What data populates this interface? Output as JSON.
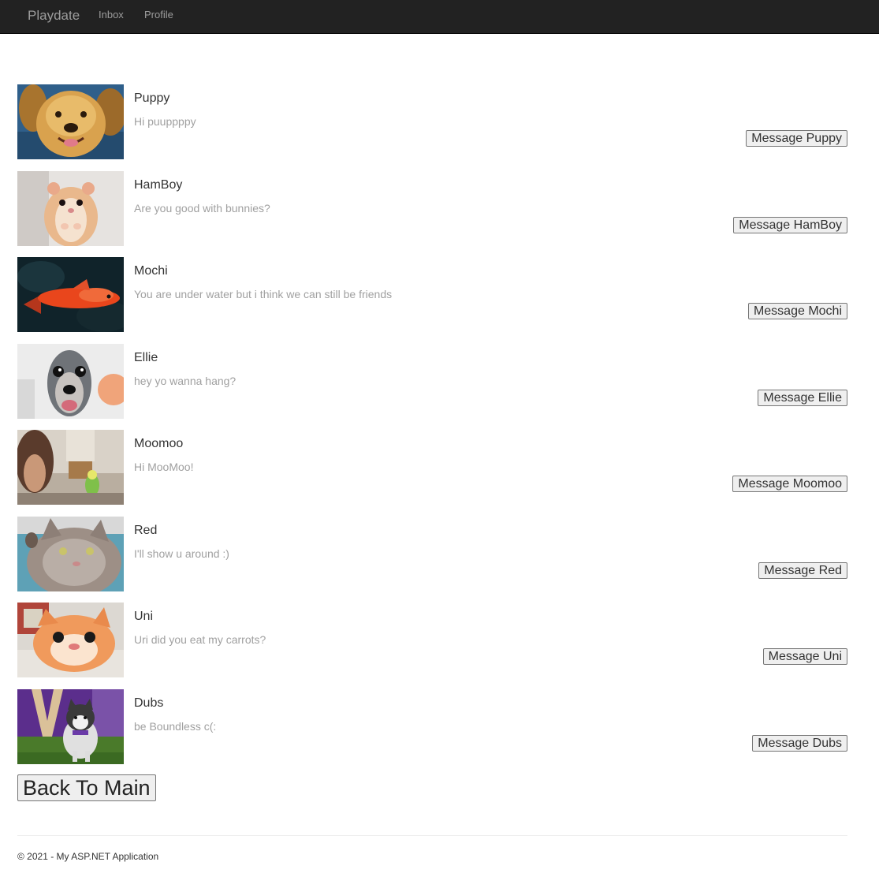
{
  "navbar": {
    "brand": "Playdate",
    "links": [
      "Inbox",
      "Profile"
    ]
  },
  "friends": [
    {
      "name": "Puppy",
      "message": "Hi puuppppy",
      "button": "Message Puppy",
      "photo": "golden-retriever-photo"
    },
    {
      "name": "HamBoy",
      "message": "Are you good with bunnies?",
      "button": "Message HamBoy",
      "photo": "hamster-photo"
    },
    {
      "name": "Mochi",
      "message": "You are under water but i think we can still be friends",
      "button": "Message Mochi",
      "photo": "goldfish-photo"
    },
    {
      "name": "Ellie",
      "message": "hey yo wanna hang?",
      "button": "Message Ellie",
      "photo": "greyhound-photo"
    },
    {
      "name": "Moomoo",
      "message": "Hi MooMoo!",
      "button": "Message Moomoo",
      "photo": "parakeet-photo"
    },
    {
      "name": "Red",
      "message": "I'll show u around :)",
      "button": "Message Red",
      "photo": "tabby-cat-photo"
    },
    {
      "name": "Uni",
      "message": "Uri did you eat my carrots?",
      "button": "Message Uni",
      "photo": "orange-cat-photo"
    },
    {
      "name": "Dubs",
      "message": "be Boundless c(:",
      "button": "Message Dubs",
      "photo": "husky-puppy-photo"
    }
  ],
  "back_button": "Back To Main",
  "footer": "© 2021 - My ASP.NET Application"
}
